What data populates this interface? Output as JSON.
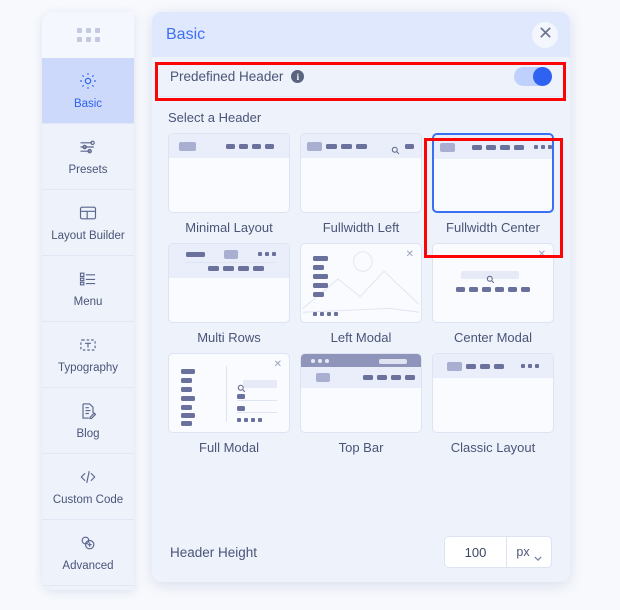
{
  "sidebar": {
    "handle_icon": "drag-dots-icon",
    "items": [
      {
        "label": "Basic",
        "icon": "gear-icon",
        "active": true
      },
      {
        "label": "Presets",
        "icon": "sliders-icon",
        "active": false
      },
      {
        "label": "Layout Builder",
        "icon": "layout-icon",
        "active": false
      },
      {
        "label": "Menu",
        "icon": "menu-list-icon",
        "active": false
      },
      {
        "label": "Typography",
        "icon": "text-box-icon",
        "active": false
      },
      {
        "label": "Blog",
        "icon": "document-edit-icon",
        "active": false
      },
      {
        "label": "Custom Code",
        "icon": "code-icon",
        "active": false
      },
      {
        "label": "Advanced",
        "icon": "settings-dots-icon",
        "active": false
      }
    ]
  },
  "modal": {
    "title": "Basic",
    "close_icon": "close-icon",
    "predefined": {
      "label": "Predefined Header",
      "info_icon": "info-icon",
      "info_glyph": "i",
      "toggle_on": true
    },
    "select_label": "Select a Header",
    "headers": [
      {
        "label": "Minimal Layout",
        "style": "minimal",
        "selected": false
      },
      {
        "label": "Fullwidth Left",
        "style": "fwleft",
        "selected": false
      },
      {
        "label": "Fullwidth Center",
        "style": "fwcenter",
        "selected": true
      },
      {
        "label": "Multi Rows",
        "style": "multirow",
        "selected": false
      },
      {
        "label": "Left Modal",
        "style": "leftmodal",
        "selected": false
      },
      {
        "label": "Center Modal",
        "style": "centermodal",
        "selected": false
      },
      {
        "label": "Full Modal",
        "style": "fullmodal",
        "selected": false
      },
      {
        "label": "Top Bar",
        "style": "topbar",
        "selected": false
      },
      {
        "label": "Classic Layout",
        "style": "classic",
        "selected": false
      }
    ],
    "footer": {
      "label": "Header Height",
      "value": "100",
      "unit": "px",
      "unit_chevron_icon": "chevron-down-icon"
    }
  },
  "annotations": {
    "colors": {
      "highlight": "#fb0505",
      "accent": "#2f62f0",
      "title": "#4070f4",
      "panel_bg": "#eef2fb",
      "header_bg": "#dfe8fd",
      "text": "#4a5578"
    },
    "boxes": [
      {
        "name": "predefined-header-highlight"
      },
      {
        "name": "fullwidth-center-highlight"
      }
    ]
  }
}
